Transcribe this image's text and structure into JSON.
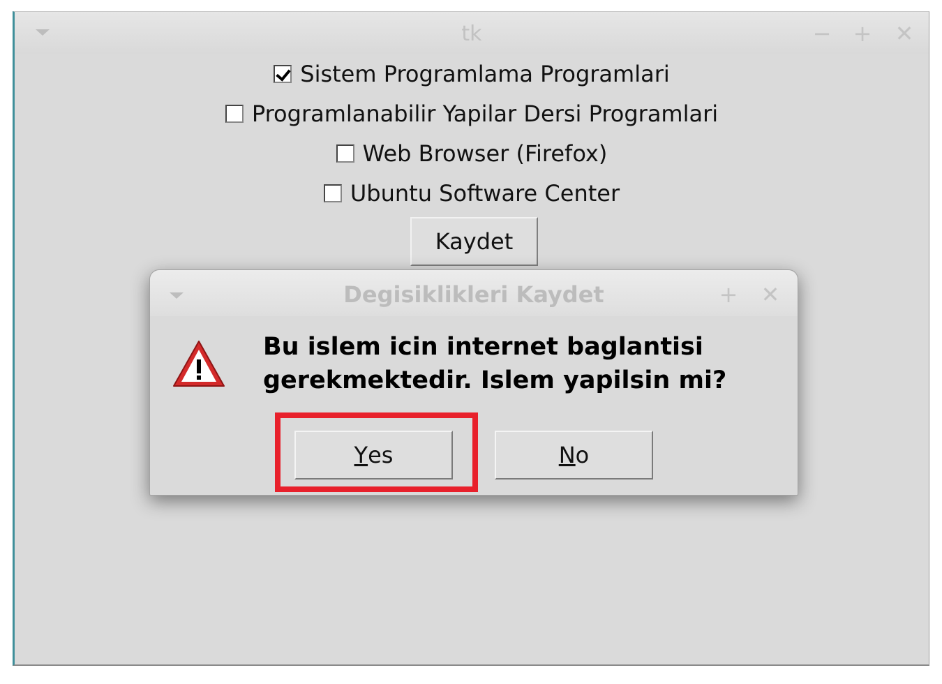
{
  "main_window": {
    "title": "tk",
    "controls": {
      "minimize": "−",
      "maximize": "+",
      "close": "✕"
    },
    "options": [
      {
        "label": "Sistem Programlama Programlari",
        "checked": true
      },
      {
        "label": "Programlanabilir Yapilar Dersi Programlari",
        "checked": false
      },
      {
        "label": "Web Browser (Firefox)",
        "checked": false
      },
      {
        "label": "Ubuntu Software Center",
        "checked": false
      }
    ],
    "save_button": "Kaydet"
  },
  "dialog": {
    "title": "Degisiklikleri Kaydet",
    "controls": {
      "maximize": "+",
      "close": "✕"
    },
    "icon": "warning-icon",
    "message_line1": "Bu islem icin internet baglantisi",
    "message_line2": "gerekmektedir. Islem yapilsin mi?",
    "yes_mnemonic": "Y",
    "yes_rest": "es",
    "no_mnemonic": "N",
    "no_rest": "o"
  },
  "colors": {
    "window_bg": "#dadada",
    "highlight": "#e8202b",
    "warning_red": "#d42a2a"
  }
}
